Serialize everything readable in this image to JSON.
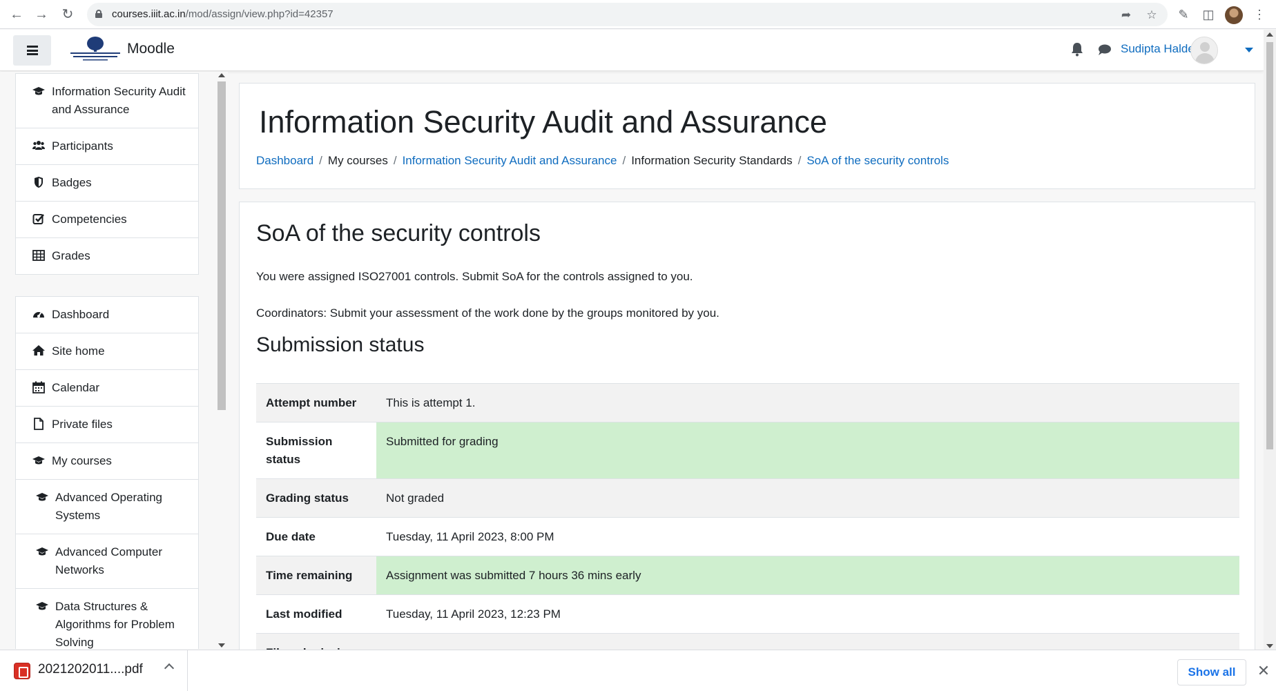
{
  "browser": {
    "url_host": "courses.iiit.ac.in",
    "url_path": "/mod/assign/view.php?id=42357"
  },
  "navbar": {
    "brand": "Moodle",
    "user_name": "Sudipta Halder"
  },
  "drawer": {
    "course_items": [
      {
        "label": "Information Security Audit and Assurance",
        "icon": "graduation-cap-icon"
      },
      {
        "label": "Participants",
        "icon": "users-icon"
      },
      {
        "label": "Badges",
        "icon": "shield-icon"
      },
      {
        "label": "Competencies",
        "icon": "check-square-icon"
      },
      {
        "label": "Grades",
        "icon": "table-icon"
      }
    ],
    "site_items": [
      {
        "label": "Dashboard",
        "icon": "dashboard-icon"
      },
      {
        "label": "Site home",
        "icon": "home-icon"
      },
      {
        "label": "Calendar",
        "icon": "calendar-icon"
      },
      {
        "label": "Private files",
        "icon": "file-icon"
      },
      {
        "label": "My courses",
        "icon": "graduation-cap-icon"
      },
      {
        "label": "Advanced Operating Systems",
        "icon": "graduation-cap-icon"
      },
      {
        "label": "Advanced Computer Networks",
        "icon": "graduation-cap-icon"
      },
      {
        "label": "Data Structures & Algorithms for Problem Solving",
        "icon": "graduation-cap-icon"
      }
    ]
  },
  "header": {
    "course_title": "Information Security Audit and Assurance",
    "breadcrumb": [
      {
        "label": "Dashboard",
        "link": true
      },
      {
        "label": "My courses",
        "link": false
      },
      {
        "label": "Information Security Audit and Assurance",
        "link": true
      },
      {
        "label": "Information Security Standards",
        "link": false
      },
      {
        "label": "SoA of the security controls",
        "link": true
      }
    ]
  },
  "main": {
    "assignment_title": "SoA of the security controls",
    "intro_1": "You were assigned ISO27001 controls. Submit SoA for the controls assigned to you.",
    "intro_2": "Coordinators: Submit your assessment of the work done by the groups monitored by you.",
    "status_heading": "Submission status",
    "status_rows": [
      {
        "label": "Attempt number",
        "value": "This is attempt 1."
      },
      {
        "label": "Submission status",
        "value": "Submitted for grading"
      },
      {
        "label": "Grading status",
        "value": "Not graded"
      },
      {
        "label": "Due date",
        "value": "Tuesday, 11 April 2023, 8:00 PM"
      },
      {
        "label": "Time remaining",
        "value": "Assignment was submitted 7 hours 36 mins early"
      },
      {
        "label": "Last modified",
        "value": "Tuesday, 11 April 2023, 12:23 PM"
      },
      {
        "label": "File submissions",
        "value": ""
      }
    ],
    "status_colors": {
      "success": "#cfefcf",
      "row_alt": "#f2f2f2"
    }
  },
  "downloads": {
    "file_name": "2021202011....pdf",
    "show_all_label": "Show all"
  },
  "colors": {
    "link": "#0f6cbf",
    "chrome_link": "#1a73e8"
  }
}
